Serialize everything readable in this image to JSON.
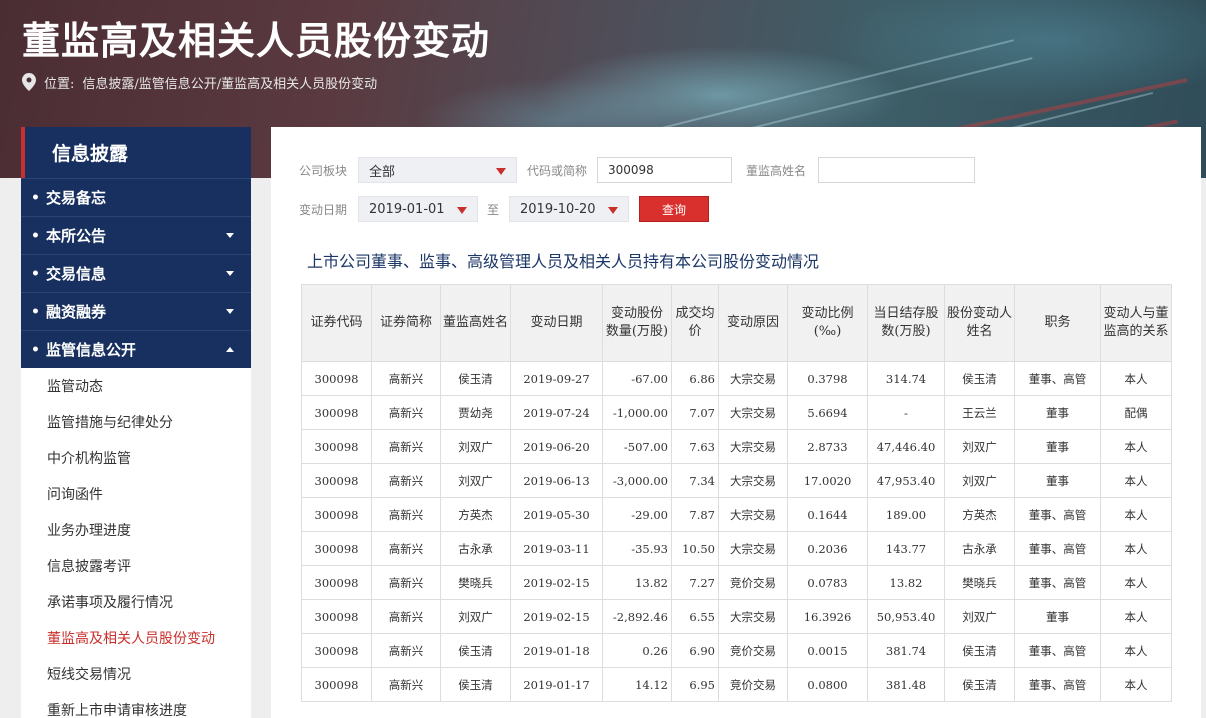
{
  "header": {
    "title": "董监高及相关人员股份变动",
    "location_label": "位置:",
    "breadcrumb": "信息披露/监管信息公开/董监高及相关人员股份变动"
  },
  "sidebar": {
    "head": "信息披露",
    "menu": [
      {
        "label": "交易备忘",
        "caret": "none"
      },
      {
        "label": "本所公告",
        "caret": "down"
      },
      {
        "label": "交易信息",
        "caret": "down"
      },
      {
        "label": "融资融券",
        "caret": "down"
      },
      {
        "label": "监管信息公开",
        "caret": "up"
      }
    ],
    "sub_items": [
      "监管动态",
      "监管措施与纪律处分",
      "中介机构监管",
      "问询函件",
      "业务办理进度",
      "信息披露考评",
      "承诺事项及履行情况",
      "董监高及相关人员股份变动",
      "短线交易情况",
      "重新上市申请审核进度"
    ],
    "active_sub": "董监高及相关人员股份变动"
  },
  "filters": {
    "board_label": "公司板块",
    "board_value": "全部",
    "code_label": "代码或简称",
    "code_value": "300098",
    "name_label": "董监高姓名",
    "name_value": "",
    "date_label": "变动日期",
    "date_from": "2019-01-01",
    "to_label": "至",
    "date_to": "2019-10-20",
    "query_label": "查询"
  },
  "section_title": "上市公司董事、监事、高级管理人员及相关人员持有本公司股份变动情况",
  "table": {
    "headers": [
      "证券代码",
      "证券简称",
      "董监高姓名",
      "变动日期",
      "变动股份数量(万股)",
      "成交均价",
      "变动原因",
      "变动比例(‰)",
      "当日结存股数(万股)",
      "股份变动人姓名",
      "职务",
      "变动人与董监高的关系"
    ],
    "rows": [
      [
        "300098",
        "高新兴",
        "侯玉清",
        "2019-09-27",
        "-67.00",
        "6.86",
        "大宗交易",
        "0.3798",
        "314.74",
        "侯玉清",
        "董事、高管",
        "本人"
      ],
      [
        "300098",
        "高新兴",
        "贾幼尧",
        "2019-07-24",
        "-1,000.00",
        "7.07",
        "大宗交易",
        "5.6694",
        "-",
        "王云兰",
        "董事",
        "配偶"
      ],
      [
        "300098",
        "高新兴",
        "刘双广",
        "2019-06-20",
        "-507.00",
        "7.63",
        "大宗交易",
        "2.8733",
        "47,446.40",
        "刘双广",
        "董事",
        "本人"
      ],
      [
        "300098",
        "高新兴",
        "刘双广",
        "2019-06-13",
        "-3,000.00",
        "7.34",
        "大宗交易",
        "17.0020",
        "47,953.40",
        "刘双广",
        "董事",
        "本人"
      ],
      [
        "300098",
        "高新兴",
        "方英杰",
        "2019-05-30",
        "-29.00",
        "7.87",
        "大宗交易",
        "0.1644",
        "189.00",
        "方英杰",
        "董事、高管",
        "本人"
      ],
      [
        "300098",
        "高新兴",
        "古永承",
        "2019-03-11",
        "-35.93",
        "10.50",
        "大宗交易",
        "0.2036",
        "143.77",
        "古永承",
        "董事、高管",
        "本人"
      ],
      [
        "300098",
        "高新兴",
        "樊晓兵",
        "2019-02-15",
        "13.82",
        "7.27",
        "竞价交易",
        "0.0783",
        "13.82",
        "樊晓兵",
        "董事、高管",
        "本人"
      ],
      [
        "300098",
        "高新兴",
        "刘双广",
        "2019-02-15",
        "-2,892.46",
        "6.55",
        "大宗交易",
        "16.3926",
        "50,953.40",
        "刘双广",
        "董事",
        "本人"
      ],
      [
        "300098",
        "高新兴",
        "侯玉清",
        "2019-01-18",
        "0.26",
        "6.90",
        "竞价交易",
        "0.0015",
        "381.74",
        "侯玉清",
        "董事、高管",
        "本人"
      ],
      [
        "300098",
        "高新兴",
        "侯玉清",
        "2019-01-17",
        "14.12",
        "6.95",
        "竞价交易",
        "0.0800",
        "381.48",
        "侯玉清",
        "董事、高管",
        "本人"
      ]
    ]
  }
}
